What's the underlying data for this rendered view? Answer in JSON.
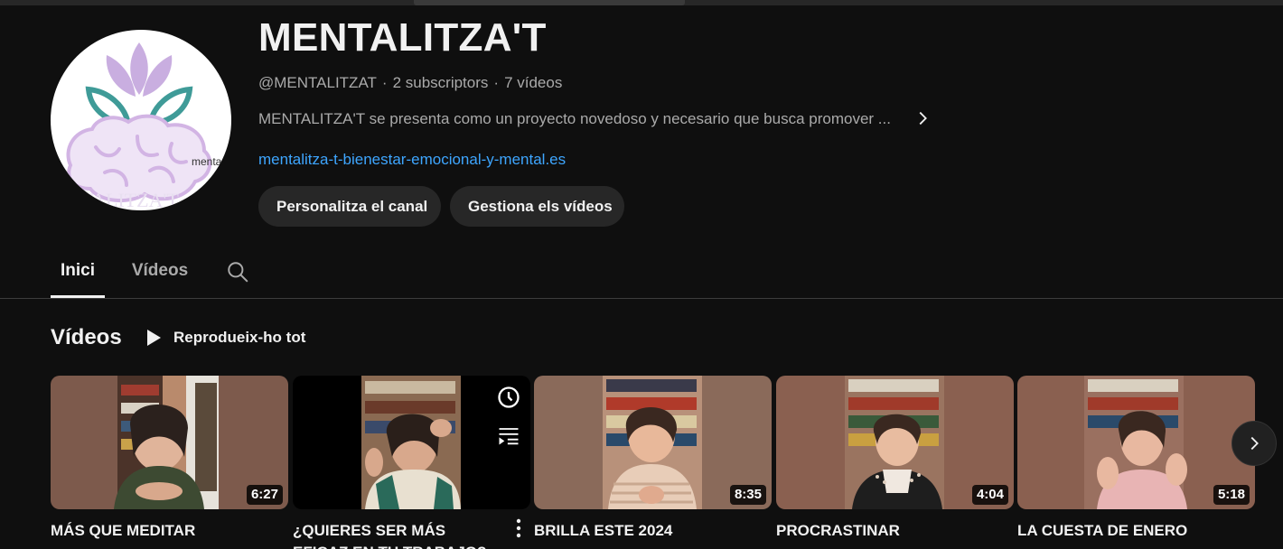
{
  "channel": {
    "name": "MENTALITZA'T",
    "handle": "@MENTALITZAT",
    "separator": "·",
    "subscribers": "2 subscriptors",
    "video_count": "7 vídeos",
    "description": "MENTALITZA'T se presenta como un proyecto novedoso y necesario que busca promover ...",
    "link": "mentalitza-t-bienestar-emocional-y-mental.es",
    "avatar_text": "menta",
    "avatar_bottom_text": "ENTALITZA'T"
  },
  "actions": {
    "customize_label": "Personalitza el canal",
    "manage_label": "Gestiona els vídeos"
  },
  "tabs": [
    {
      "label": "Inici",
      "selected": true
    },
    {
      "label": "Vídeos",
      "selected": false
    }
  ],
  "section": {
    "title": "Vídeos",
    "play_all_label": "Reprodueix-ho tot"
  },
  "videos": [
    {
      "title": "MÁS QUE MEDITAR",
      "duration": "6:27"
    },
    {
      "title": "¿QUIERES SER MÁS EFICAZ EN TU TRABAJO?",
      "duration": ""
    },
    {
      "title": "BRILLA ESTE 2024",
      "duration": "8:35"
    },
    {
      "title": "PROCRASTINAR",
      "duration": "4:04"
    },
    {
      "title": "LA CUESTA DE ENERO",
      "duration": "5:18"
    }
  ],
  "icons": {
    "search": "search-icon",
    "play": "play-icon",
    "chevron": "chevron-right-icon",
    "watch_later": "clock-icon",
    "add_to_queue": "queue-icon",
    "more": "more-vertical-icon"
  },
  "colors": {
    "background": "#0f0f0f",
    "button_bg": "#272727",
    "link": "#3ea6ff",
    "text_secondary": "#aaaaaa"
  }
}
